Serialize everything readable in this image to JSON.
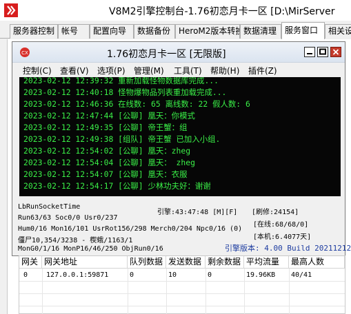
{
  "window": {
    "title": "V8M2引擎控制台-1.76初恋月卡一区 [D:\\MirServer"
  },
  "tabs": [
    {
      "label": "服务器控制"
    },
    {
      "label": "帐号"
    },
    {
      "label": "配置向导"
    },
    {
      "label": "数据备份"
    },
    {
      "label": "HeroM2版本转换"
    },
    {
      "label": "数据清理"
    },
    {
      "label": "服务窗口"
    },
    {
      "label": "相关设"
    }
  ],
  "active_tab": "服务窗口",
  "inner_window": {
    "icon_text": "CX",
    "title": "1.76初恋月卡一区 [无限版]"
  },
  "menu": [
    {
      "label": "控制(C)"
    },
    {
      "label": "查看(V)"
    },
    {
      "label": "选项(P)"
    },
    {
      "label": "管理(M)"
    },
    {
      "label": "工具(T)"
    },
    {
      "label": "帮助(H)"
    },
    {
      "label": "插件(Z)"
    }
  ],
  "log_lines": [
    "2023-02-12 12:39:32 重新加载怪物数据库完成...",
    "2023-02-12 12:40:18 怪物爆物品列表重加载完成...",
    "2023-02-12 12:46:36 在线数: 65 离线数: 22 假人数: 6",
    "2023-02-12 12:47:44 [公聊] 凰天：你模式",
    "2023-02-12 12:49:35 [公聊] 帝王蟹：组",
    "2023-02-12 12:49:38 [组队] 帝王蟹 已加入小组.",
    "2023-02-12 12:54:02 [公聊] 凰天：zheg",
    "2023-02-12 12:54:04 [公聊] 凰天： zheg",
    "2023-02-12 12:54:07 [公聊] 凰天：衣服",
    "2023-02-12 12:54:17 [公聊] 少林功夫好：谢谢"
  ],
  "status": {
    "runsocket": "LbRunSocketTime",
    "engine_time": "引擎:43:47:48 [M][F]",
    "refresh": "[刷修:24154]",
    "run_soc": "Run63/63 Soc0/0 Usr0/237",
    "online": "[在线:68/68/0]",
    "hum": "Hum0/16 Mon16/101 UsrRot156/298 Merch0/204 Npc0/16 (0)",
    "local": "[本机:6.4077天]",
    "zombie": "僵尸10,354/3238 - 楔蛾/1163/1",
    "mon": "MonG0/1/16 MonP16/46/250 ObjRun0/16",
    "version": "引擎版本: 4.00 Build 20211212"
  },
  "gateway_table": {
    "headers": [
      "网关",
      "网关地址",
      "队列数据",
      "发送数据",
      "剩余数据",
      "平均流量",
      "最高人数"
    ],
    "rows": [
      [
        "0",
        "127.0.0.1:59871",
        "0",
        "10",
        "0",
        "19.96KB",
        "40/41"
      ]
    ]
  },
  "colors": {
    "console_bg": "#060606",
    "console_text": "#3aef47",
    "version_text": "#1d3ca0",
    "close_button": "#c43b2c"
  }
}
